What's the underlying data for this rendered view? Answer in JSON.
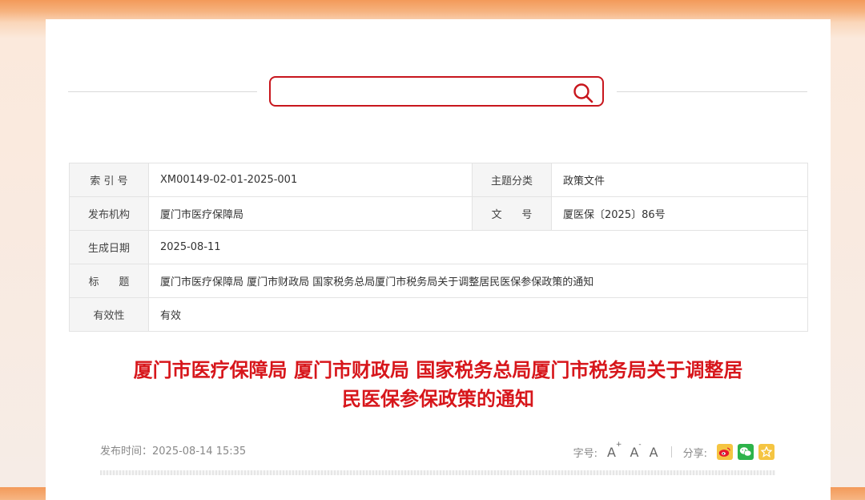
{
  "search": {
    "placeholder": "",
    "value": ""
  },
  "meta": {
    "index_label": "索 引 号",
    "index_value": "XM00149-02-01-2025-001",
    "topic_label": "主题分类",
    "topic_value": "政策文件",
    "publisher_label": "发布机构",
    "publisher_value": "厦门市医疗保障局",
    "docno_label": "文      号",
    "docno_value": "厦医保〔2025〕86号",
    "date_label": "生成日期",
    "date_value": "2025-08-11",
    "title_label": "标      题",
    "title_value": "厦门市医疗保障局 厦门市财政局 国家税务总局厦门市税务局关于调整居民医保参保政策的通知",
    "validity_label": "有效性",
    "validity_value": "有效"
  },
  "article": {
    "title_line1": "厦门市医疗保障局 厦门市财政局 国家税务总局厦门市税务局关于调整居",
    "title_line2": "民医保参保政策的通知",
    "pub_label": "发布时间：",
    "pub_time": "2025-08-14 15:35",
    "font_size_label": "字号:",
    "font_large": "A",
    "font_large_sup": "+",
    "font_small": "A",
    "font_small_sup": "-",
    "font_reset": "A",
    "share_label": "分享:"
  },
  "icons": {
    "search": "search-icon",
    "weibo": "weibo-icon",
    "wechat": "wechat-icon",
    "favorite": "star-icon"
  },
  "colors": {
    "accent_red": "#d7161b",
    "wechat_green": "#2db34a",
    "weibo_yellow": "#f5c542"
  }
}
